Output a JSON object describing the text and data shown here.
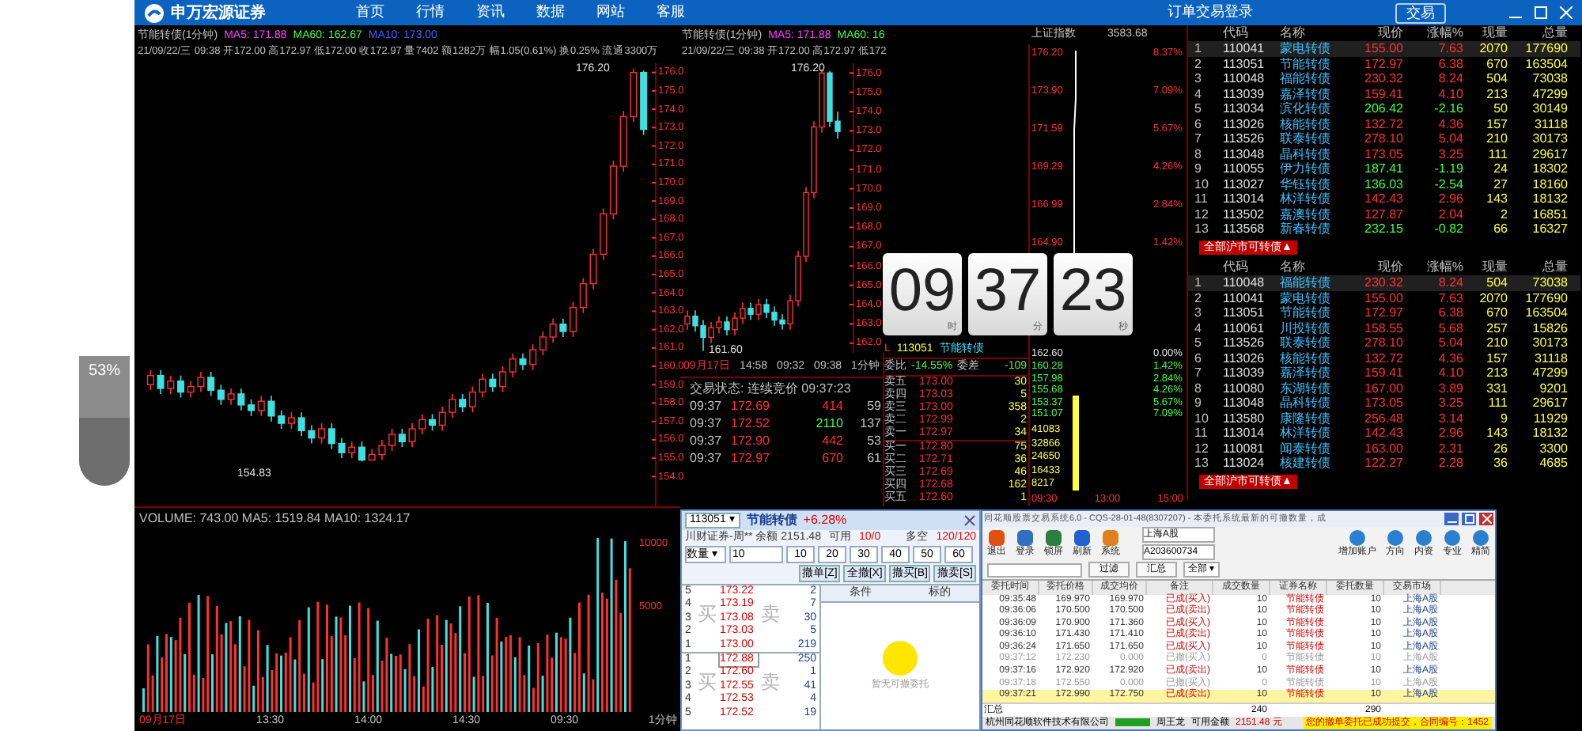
{
  "header": {
    "logo": "申万宏源证券",
    "nav": [
      "首页",
      "行情",
      "资讯",
      "数据",
      "网站",
      "客服"
    ],
    "login": "订单交易登录",
    "trade_button": "交易"
  },
  "side_widget": {
    "label": "53%",
    "level": 0.53
  },
  "main_chart": {
    "title": "节能转债(1分钟)",
    "ma": [
      {
        "text": "MA5: 171.88",
        "color": "#ff40ff"
      },
      {
        "text": "MA60: 162.67",
        "color": "#40ff40"
      },
      {
        "text": "MA10: 173.00",
        "color": "#4060ff"
      }
    ],
    "info": "21/09/22/三 09:38 开172.00 高172.97 低172.00 收172.97 量7402 额1282万 幅1.05(0.61%) 换0.25% 流通3300万",
    "high_label": "176.20",
    "low_label": "154.83",
    "chart_data": {
      "type": "candlestick",
      "ylim": [
        153.5,
        176.5
      ],
      "yticks": [
        {
          "value": 176,
          "label": "176.0"
        },
        {
          "value": 175,
          "label": "175.0"
        },
        {
          "value": 174,
          "label": "174.0"
        },
        {
          "value": 173,
          "label": "173.0"
        },
        {
          "value": 172,
          "label": "172.0"
        },
        {
          "value": 171,
          "label": "171.0"
        },
        {
          "value": 170,
          "label": "170.0"
        },
        {
          "value": 169,
          "label": "169.0"
        },
        {
          "value": 168,
          "label": "168.0"
        },
        {
          "value": 167,
          "label": "167.0"
        },
        {
          "value": 166,
          "label": "166.0"
        },
        {
          "value": 165,
          "label": "165.0"
        },
        {
          "value": 164,
          "label": "164.0"
        },
        {
          "value": 163,
          "label": "163.0"
        },
        {
          "value": 162,
          "label": "162.0"
        },
        {
          "value": 161,
          "label": "161.0"
        },
        {
          "value": 160,
          "label": "160.0"
        },
        {
          "value": 159,
          "label": "159.0"
        },
        {
          "value": 158,
          "label": "158.0"
        },
        {
          "value": 157,
          "label": "157.0"
        },
        {
          "value": 156,
          "label": "156.0"
        },
        {
          "value": 155,
          "label": "155.0"
        },
        {
          "value": 154,
          "label": "154.0"
        }
      ],
      "ohlc": [
        [
          159.0,
          159.8,
          158.7,
          159.5
        ],
        [
          159.5,
          159.8,
          158.5,
          158.8
        ],
        [
          158.8,
          159.5,
          158.5,
          159.2
        ],
        [
          159.2,
          159.5,
          158.3,
          158.6
        ],
        [
          158.6,
          159.2,
          158.3,
          158.9
        ],
        [
          158.9,
          159.7,
          158.6,
          159.4
        ],
        [
          159.4,
          159.7,
          158.4,
          158.7
        ],
        [
          158.7,
          159.0,
          157.9,
          158.2
        ],
        [
          158.2,
          158.8,
          157.9,
          158.5
        ],
        [
          158.5,
          158.8,
          157.6,
          157.9
        ],
        [
          157.9,
          158.2,
          157.3,
          157.6
        ],
        [
          157.6,
          158.4,
          157.3,
          158.1
        ],
        [
          158.1,
          158.4,
          157.0,
          157.3
        ],
        [
          157.3,
          157.6,
          156.6,
          156.9
        ],
        [
          156.9,
          157.5,
          156.6,
          157.2
        ],
        [
          157.2,
          157.5,
          156.2,
          156.5
        ],
        [
          156.5,
          156.8,
          155.8,
          156.1
        ],
        [
          156.1,
          156.9,
          155.8,
          156.6
        ],
        [
          156.6,
          156.9,
          155.5,
          155.8
        ],
        [
          155.8,
          156.1,
          155.0,
          155.3
        ],
        [
          155.3,
          155.9,
          155.0,
          155.6
        ],
        [
          155.6,
          155.9,
          154.83,
          154.9
        ],
        [
          154.9,
          155.5,
          154.9,
          155.2
        ],
        [
          155.2,
          156.0,
          154.9,
          155.7
        ],
        [
          155.7,
          156.6,
          155.4,
          156.3
        ],
        [
          156.3,
          156.6,
          155.6,
          155.9
        ],
        [
          155.9,
          156.9,
          155.6,
          156.6
        ],
        [
          156.6,
          157.4,
          156.3,
          157.1
        ],
        [
          157.1,
          157.4,
          156.5,
          156.8
        ],
        [
          156.8,
          157.8,
          156.5,
          157.5
        ],
        [
          157.5,
          158.5,
          157.2,
          158.2
        ],
        [
          158.2,
          158.5,
          157.5,
          157.8
        ],
        [
          157.8,
          158.9,
          157.5,
          158.6
        ],
        [
          158.6,
          159.6,
          158.3,
          159.3
        ],
        [
          159.3,
          159.6,
          158.6,
          158.9
        ],
        [
          158.9,
          160.0,
          158.6,
          159.7
        ],
        [
          159.7,
          160.7,
          159.4,
          160.4
        ],
        [
          160.4,
          160.7,
          159.8,
          160.1
        ],
        [
          160.1,
          161.2,
          159.8,
          160.9
        ],
        [
          160.9,
          161.9,
          160.6,
          161.6
        ],
        [
          161.6,
          162.6,
          161.3,
          162.3
        ],
        [
          162.3,
          162.6,
          161.6,
          161.9
        ],
        [
          161.9,
          163.5,
          161.6,
          163.2
        ],
        [
          163.2,
          164.8,
          162.9,
          164.5
        ],
        [
          164.5,
          166.4,
          164.2,
          166.1
        ],
        [
          166.1,
          168.6,
          165.8,
          168.3
        ],
        [
          168.3,
          171.2,
          168.0,
          170.9
        ],
        [
          170.9,
          173.9,
          170.6,
          173.6
        ],
        [
          173.6,
          176.2,
          173.3,
          176.0
        ],
        [
          176.0,
          176.1,
          172.6,
          172.9
        ]
      ]
    }
  },
  "mini_chart": {
    "title": "节能转债(1分钟)",
    "ma": [
      {
        "text": "MA5: 171.88",
        "color": "#ff40ff"
      },
      {
        "text": "MA60: 16",
        "color": "#40ff40"
      }
    ],
    "info": "21/09/22/三 09:38 开172.00 高172.97 低172",
    "high_label": "176.20",
    "low_label": "161.60",
    "time_labels": [
      "09月17日",
      "14:58",
      "09:32",
      "09:38",
      "1分钟"
    ],
    "chart_data": {
      "type": "candlestick",
      "ylim": [
        161.5,
        176.5
      ],
      "yticks": [
        {
          "value": 176,
          "label": "176.0"
        },
        {
          "value": 175,
          "label": "175.0"
        },
        {
          "value": 174,
          "label": "174.0"
        },
        {
          "value": 173,
          "label": "173.0"
        },
        {
          "value": 172,
          "label": "172.0"
        },
        {
          "value": 171,
          "label": "171.0"
        },
        {
          "value": 170,
          "label": "170.0"
        },
        {
          "value": 169,
          "label": "169.0"
        },
        {
          "value": 168,
          "label": "168.0"
        },
        {
          "value": 167,
          "label": "167.0"
        },
        {
          "value": 166,
          "label": "166.0"
        },
        {
          "value": 165,
          "label": "165.0"
        },
        {
          "value": 164,
          "label": "164.0"
        },
        {
          "value": 163,
          "label": "163.0"
        },
        {
          "value": 162,
          "label": "162.0"
        }
      ],
      "ohlc": [
        [
          163.0,
          163.7,
          162.7,
          163.4
        ],
        [
          163.4,
          163.7,
          162.6,
          162.9
        ],
        [
          162.9,
          163.2,
          161.6,
          162.3
        ],
        [
          162.3,
          163.1,
          162.0,
          162.8
        ],
        [
          162.8,
          163.4,
          162.5,
          163.1
        ],
        [
          163.1,
          163.4,
          162.4,
          162.7
        ],
        [
          162.7,
          163.6,
          162.4,
          163.3
        ],
        [
          163.3,
          164.1,
          163.0,
          163.8
        ],
        [
          163.8,
          164.1,
          163.2,
          163.5
        ],
        [
          163.5,
          164.3,
          163.2,
          164.0
        ],
        [
          164.0,
          164.3,
          163.3,
          163.6
        ],
        [
          163.6,
          163.9,
          162.9,
          163.2
        ],
        [
          163.2,
          163.5,
          162.7,
          163.0
        ],
        [
          163.0,
          164.5,
          162.7,
          164.2
        ],
        [
          164.2,
          166.8,
          163.9,
          166.5
        ],
        [
          166.5,
          170.1,
          166.2,
          169.8
        ],
        [
          169.8,
          173.5,
          169.5,
          173.2
        ],
        [
          173.2,
          176.2,
          172.9,
          176.0
        ],
        [
          176.0,
          176.1,
          173.2,
          173.5
        ],
        [
          173.5,
          174.0,
          172.6,
          172.97
        ]
      ]
    }
  },
  "ticks": {
    "title": "交易状态: 连续竞价 09:37:23",
    "rows": [
      {
        "time": "09:37",
        "price": "172.69",
        "volume": "414",
        "count": "59",
        "up": true
      },
      {
        "time": "09:37",
        "price": "172.52",
        "volume": "2110",
        "count": "137",
        "up": false
      },
      {
        "time": "09:37",
        "price": "172.90",
        "volume": "442",
        "count": "53",
        "up": true
      },
      {
        "time": "09:37",
        "price": "172.97",
        "volume": "670",
        "count": "61",
        "up": true
      }
    ]
  },
  "clock": {
    "hour": "09",
    "minute": "37",
    "second": "23",
    "units": [
      "时",
      "分",
      "秒"
    ]
  },
  "quote": {
    "market": "L",
    "code": "113051",
    "name": "节能转债",
    "ratio_label": "委比",
    "ratio": "-14.55%",
    "diff_label": "委差",
    "diff": "-109",
    "asks": [
      {
        "label": "卖五",
        "price": "173.00",
        "volume": "30"
      },
      {
        "label": "卖四",
        "price": "173.03",
        "volume": "5"
      },
      {
        "label": "卖三",
        "price": "173.00",
        "volume": "358"
      },
      {
        "label": "卖二",
        "price": "172.99",
        "volume": "2"
      },
      {
        "label": "卖一",
        "price": "172.97",
        "volume": "34"
      }
    ],
    "bids": [
      {
        "label": "买一",
        "price": "172.80",
        "volume": "75"
      },
      {
        "label": "买二",
        "price": "172.71",
        "volume": "36"
      },
      {
        "label": "买三",
        "price": "172.69",
        "volume": "46"
      },
      {
        "label": "买四",
        "price": "172.68",
        "volume": "162"
      },
      {
        "label": "买五",
        "price": "172.60",
        "volume": "1"
      }
    ]
  },
  "day_chart": {
    "index_name": "上证指数",
    "index_value": "3583.68",
    "up_prices": [
      "176.20",
      "173.90",
      "171.59",
      "169.29",
      "166.99",
      "164.90"
    ],
    "mid_price": "162.60",
    "down_prices": [
      "160.28",
      "157.98",
      "155.68",
      "153.37",
      "151.07"
    ],
    "up_percents": [
      "8.37%",
      "7.09%",
      "5.67%",
      "4.26%",
      "2.84%",
      "1.42%"
    ],
    "mid_percent": "0.00%",
    "down_percents": [
      "1.42%",
      "2.84%",
      "4.26%",
      "5.67%",
      "7.09%"
    ],
    "volume_labels": [
      "41083",
      "32866",
      "24650",
      "16433",
      "8217"
    ],
    "time_labels": [
      "09:30",
      "13:00",
      "15:00"
    ]
  },
  "quote_tables": [
    {
      "tab": "全部沪市可转债▲",
      "columns": [
        "代码",
        "名称",
        "现价",
        "涨幅%",
        "现量",
        "总量"
      ],
      "rows": [
        {
          "index": "1",
          "code": "110041",
          "name": "蒙电转债",
          "price": "155.00",
          "change": "7.63",
          "now": "2070",
          "total": "177690",
          "up": true,
          "selected": true
        },
        {
          "index": "2",
          "code": "113051",
          "name": "节能转债",
          "price": "172.97",
          "change": "6.38",
          "now": "670",
          "total": "163504",
          "up": true,
          "selected": false
        },
        {
          "index": "3",
          "code": "110048",
          "name": "福能转债",
          "price": "230.32",
          "change": "8.24",
          "now": "504",
          "total": "73038",
          "up": true,
          "selected": false
        },
        {
          "index": "4",
          "code": "113039",
          "name": "嘉泽转债",
          "price": "159.41",
          "change": "4.10",
          "now": "213",
          "total": "47299",
          "up": true,
          "selected": false
        },
        {
          "index": "5",
          "code": "113034",
          "name": "滨化转债",
          "price": "206.42",
          "change": "-2.16",
          "now": "50",
          "total": "30149",
          "up": false,
          "selected": false
        },
        {
          "index": "6",
          "code": "113026",
          "name": "核能转债",
          "price": "132.72",
          "change": "4.36",
          "now": "157",
          "total": "31118",
          "up": true,
          "selected": false
        },
        {
          "index": "7",
          "code": "113526",
          "name": "联泰转债",
          "price": "278.10",
          "change": "5.04",
          "now": "210",
          "total": "30173",
          "up": true,
          "selected": false
        },
        {
          "index": "8",
          "code": "113048",
          "name": "晶科转债",
          "price": "173.05",
          "change": "3.25",
          "now": "111",
          "total": "29617",
          "up": true,
          "selected": false
        },
        {
          "index": "9",
          "code": "110055",
          "name": "伊力转债",
          "price": "187.41",
          "change": "-1.19",
          "now": "24",
          "total": "18302",
          "up": false,
          "selected": false
        },
        {
          "index": "10",
          "code": "113027",
          "name": "华钰转债",
          "price": "136.03",
          "change": "-2.54",
          "now": "27",
          "total": "18160",
          "up": false,
          "selected": false
        },
        {
          "index": "11",
          "code": "113014",
          "name": "林洋转债",
          "price": "142.43",
          "change": "2.96",
          "now": "143",
          "total": "18132",
          "up": true,
          "selected": false
        },
        {
          "index": "12",
          "code": "113502",
          "name": "嘉澳转债",
          "price": "127.87",
          "change": "2.04",
          "now": "2",
          "total": "16851",
          "up": true,
          "selected": false
        },
        {
          "index": "13",
          "code": "113568",
          "name": "新春转债",
          "price": "232.15",
          "change": "-0.82",
          "now": "66",
          "total": "16327",
          "up": false,
          "selected": false
        }
      ]
    },
    {
      "tab": "全部沪市可转债▲",
      "columns": [
        "代码",
        "名称",
        "现价",
        "涨幅%",
        "现量",
        "总量"
      ],
      "rows": [
        {
          "index": "1",
          "code": "110048",
          "name": "福能转债",
          "price": "230.32",
          "change": "8.24",
          "now": "504",
          "total": "73038",
          "up": true,
          "selected": true
        },
        {
          "index": "2",
          "code": "110041",
          "name": "蒙电转债",
          "price": "155.00",
          "change": "7.63",
          "now": "2070",
          "total": "177690",
          "up": true,
          "selected": false
        },
        {
          "index": "3",
          "code": "113051",
          "name": "节能转债",
          "price": "172.97",
          "change": "6.38",
          "now": "670",
          "total": "163504",
          "up": true,
          "selected": false
        },
        {
          "index": "4",
          "code": "110061",
          "name": "川投转债",
          "price": "158.55",
          "change": "5.68",
          "now": "257",
          "total": "15826",
          "up": true,
          "selected": false
        },
        {
          "index": "5",
          "code": "113526",
          "name": "联泰转债",
          "price": "278.10",
          "change": "5.04",
          "now": "210",
          "total": "30173",
          "up": true,
          "selected": false
        },
        {
          "index": "6",
          "code": "113026",
          "name": "核能转债",
          "price": "132.72",
          "change": "4.36",
          "now": "157",
          "total": "31118",
          "up": true,
          "selected": false
        },
        {
          "index": "7",
          "code": "113039",
          "name": "嘉泽转债",
          "price": "159.41",
          "change": "4.10",
          "now": "213",
          "total": "47299",
          "up": true,
          "selected": false
        },
        {
          "index": "8",
          "code": "110080",
          "name": "东湖转债",
          "price": "167.00",
          "change": "3.89",
          "now": "331",
          "total": "9201",
          "up": true,
          "selected": false
        },
        {
          "index": "9",
          "code": "113048",
          "name": "晶科转债",
          "price": "173.05",
          "change": "3.25",
          "now": "111",
          "total": "29617",
          "up": true,
          "selected": false
        },
        {
          "index": "10",
          "code": "113580",
          "name": "康隆转债",
          "price": "256.48",
          "change": "3.14",
          "now": "9",
          "total": "11929",
          "up": true,
          "selected": false
        },
        {
          "index": "11",
          "code": "113014",
          "name": "林洋转债",
          "price": "142.43",
          "change": "2.96",
          "now": "143",
          "total": "18132",
          "up": true,
          "selected": false
        },
        {
          "index": "12",
          "code": "110081",
          "name": "闻泰转债",
          "price": "163.00",
          "change": "2.31",
          "now": "26",
          "total": "3300",
          "up": true,
          "selected": false
        },
        {
          "index": "13",
          "code": "113024",
          "name": "核建转债",
          "price": "122.27",
          "change": "2.28",
          "now": "36",
          "total": "4685",
          "up": true,
          "selected": false
        }
      ]
    }
  ],
  "volume_chart": {
    "info": "VOLUME: 743.00 MA5: 1519.84 MA10: 1324.17",
    "labels": [
      "10000",
      "5000"
    ],
    "time_labels": [
      "09月17日",
      "13:30",
      "14:00",
      "14:30",
      "09:30",
      "1分钟"
    ]
  },
  "order_dialog": {
    "code": "113051 ▾",
    "name": "节能转债",
    "change": "+6.28%",
    "account": "川财证券-周** 余额 2151.48",
    "available_label": "可用",
    "available": "10/0",
    "long_short_label": "多空",
    "long_short": "120/120",
    "qty_label": "数量 ▾",
    "qty": "10",
    "presets": [
      "10",
      "20",
      "30",
      "40",
      "50",
      "60"
    ],
    "actions": [
      "撤单[Z]",
      "全撤[X]",
      "撤买[B]",
      "撤卖[S]"
    ],
    "sells": [
      {
        "level": "5",
        "price": "173.22",
        "volume": "2"
      },
      {
        "level": "4",
        "price": "173.19",
        "volume": "7"
      },
      {
        "level": "3",
        "price": "173.08",
        "volume": "30"
      },
      {
        "level": "2",
        "price": "173.03",
        "volume": "5"
      },
      {
        "level": "1",
        "price": "173.00",
        "volume": "219"
      }
    ],
    "buys": [
      {
        "level": "1",
        "price": "172.88",
        "volume": "250",
        "selected": true
      },
      {
        "level": "2",
        "price": "172.60",
        "volume": "1",
        "selected": false
      },
      {
        "level": "3",
        "price": "172.55",
        "volume": "41",
        "selected": false
      },
      {
        "level": "4",
        "price": "172.53",
        "volume": "4",
        "selected": false
      },
      {
        "level": "5",
        "price": "172.52",
        "volume": "19",
        "selected": false
      }
    ],
    "watermarks": [
      "买",
      "卖",
      "买",
      "卖"
    ],
    "columns": [
      "条件",
      "标的"
    ],
    "empty": "暂无可撤委托"
  },
  "trade_window": {
    "title": "同花顺股票交易系统6.0 - CQS-28-01-48(8307207) - 本委托系统最新的可撤数量，成",
    "toolbar": [
      "退出",
      "登录",
      "锁屏",
      "刷新",
      "系统"
    ],
    "market": "上海A股",
    "account": "A203600734",
    "right_tools": [
      "增加账户",
      "方向",
      "内资",
      "专业",
      "精简"
    ],
    "filter_buttons": [
      "过滤",
      "汇总"
    ],
    "scope": "全部 ▾",
    "columns": [
      "委托时间",
      "委托价格",
      "成交均价",
      "备注",
      "成交数量",
      "证券名称",
      "委托数量",
      "交易市场"
    ],
    "rows": [
      {
        "cells": [
          "09:35:48",
          "169.970",
          "169.970",
          "已成(买入)",
          "10",
          "节能转债",
          "10",
          "上海A股"
        ],
        "kind": "filled",
        "selected": false
      },
      {
        "cells": [
          "09:36:06",
          "170.500",
          "170.500",
          "已成(卖出)",
          "10",
          "节能转债",
          "10",
          "上海A股"
        ],
        "kind": "filled",
        "selected": false
      },
      {
        "cells": [
          "09:36:09",
          "170.900",
          "171.360",
          "已成(买入)",
          "10",
          "节能转债",
          "10",
          "上海A股"
        ],
        "kind": "filled",
        "selected": false
      },
      {
        "cells": [
          "09:36:10",
          "171.430",
          "171.410",
          "已成(卖出)",
          "10",
          "节能转债",
          "10",
          "上海A股"
        ],
        "kind": "filled",
        "selected": false
      },
      {
        "cells": [
          "09:36:24",
          "171.650",
          "171.650",
          "已成(买入)",
          "10",
          "节能转债",
          "10",
          "上海A股"
        ],
        "kind": "filled",
        "selected": false
      },
      {
        "cells": [
          "09:37:12",
          "172.230",
          "0.000",
          "已撤(买入)",
          "0",
          "节能转债",
          "10",
          "上海A股"
        ],
        "kind": "cancelled",
        "selected": false
      },
      {
        "cells": [
          "09:37:16",
          "172.920",
          "172.920",
          "已成(卖出)",
          "10",
          "节能转债",
          "10",
          "上海A股"
        ],
        "kind": "filled",
        "selected": false
      },
      {
        "cells": [
          "09:37:18",
          "172.550",
          "0.000",
          "已撤(买入)",
          "0",
          "节能转债",
          "10",
          "上海A股"
        ],
        "kind": "cancelled",
        "selected": false
      },
      {
        "cells": [
          "09:37:21",
          "172.990",
          "172.750",
          "已成(卖出)",
          "10",
          "节能转债",
          "10",
          "上海A股"
        ],
        "kind": "filled",
        "selected": true
      }
    ],
    "summary": {
      "label": "汇总",
      "filled": "240",
      "ordered": "290"
    },
    "status": [
      "杭州同花顺软件技术有限公司",
      "周王龙",
      "可用金额",
      "2151.48 元"
    ],
    "notice": "您的撤单委托已成功提交，合同编号：1452"
  }
}
